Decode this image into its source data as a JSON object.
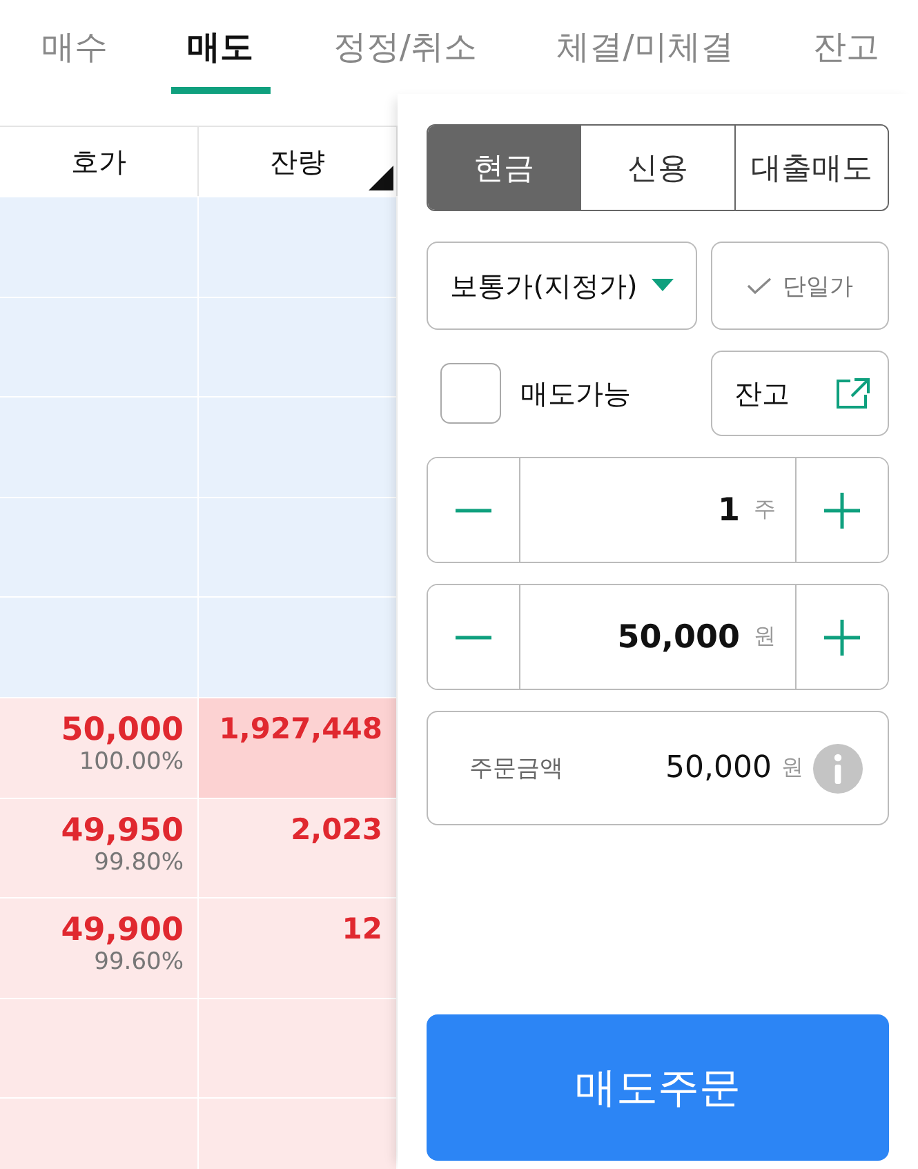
{
  "tabs": [
    {
      "label": "매수",
      "selected": false
    },
    {
      "label": "매도",
      "selected": true
    },
    {
      "label": "정정/취소",
      "selected": false
    },
    {
      "label": "체결/미체결",
      "selected": false
    },
    {
      "label": "잔고",
      "selected": false
    }
  ],
  "orderbook": {
    "columns": [
      "호가",
      "잔량"
    ],
    "bid_rows": [
      {
        "price": "50,000",
        "percent": "100.00%",
        "volume": "1,927,448",
        "highlighted": true
      },
      {
        "price": "49,950",
        "percent": "99.80%",
        "volume": "2,023",
        "highlighted": false
      },
      {
        "price": "49,900",
        "percent": "99.60%",
        "volume": "12",
        "highlighted": false
      }
    ]
  },
  "credit_types": [
    {
      "label": "현금",
      "selected": true
    },
    {
      "label": "신용",
      "selected": false
    },
    {
      "label": "대출매도",
      "selected": false
    }
  ],
  "order_type": {
    "value": "보통가(지정가)"
  },
  "single_price": {
    "label": "단일가",
    "checked": false
  },
  "sellable": {
    "label": "매도가능",
    "checked": false
  },
  "balance_button": "잔고",
  "quantity": {
    "value": "1",
    "unit": "주"
  },
  "price": {
    "value": "50,000",
    "unit": "원"
  },
  "amount": {
    "label": "주문금액",
    "value": "50,000",
    "unit": "원"
  },
  "submit": "매도주문"
}
